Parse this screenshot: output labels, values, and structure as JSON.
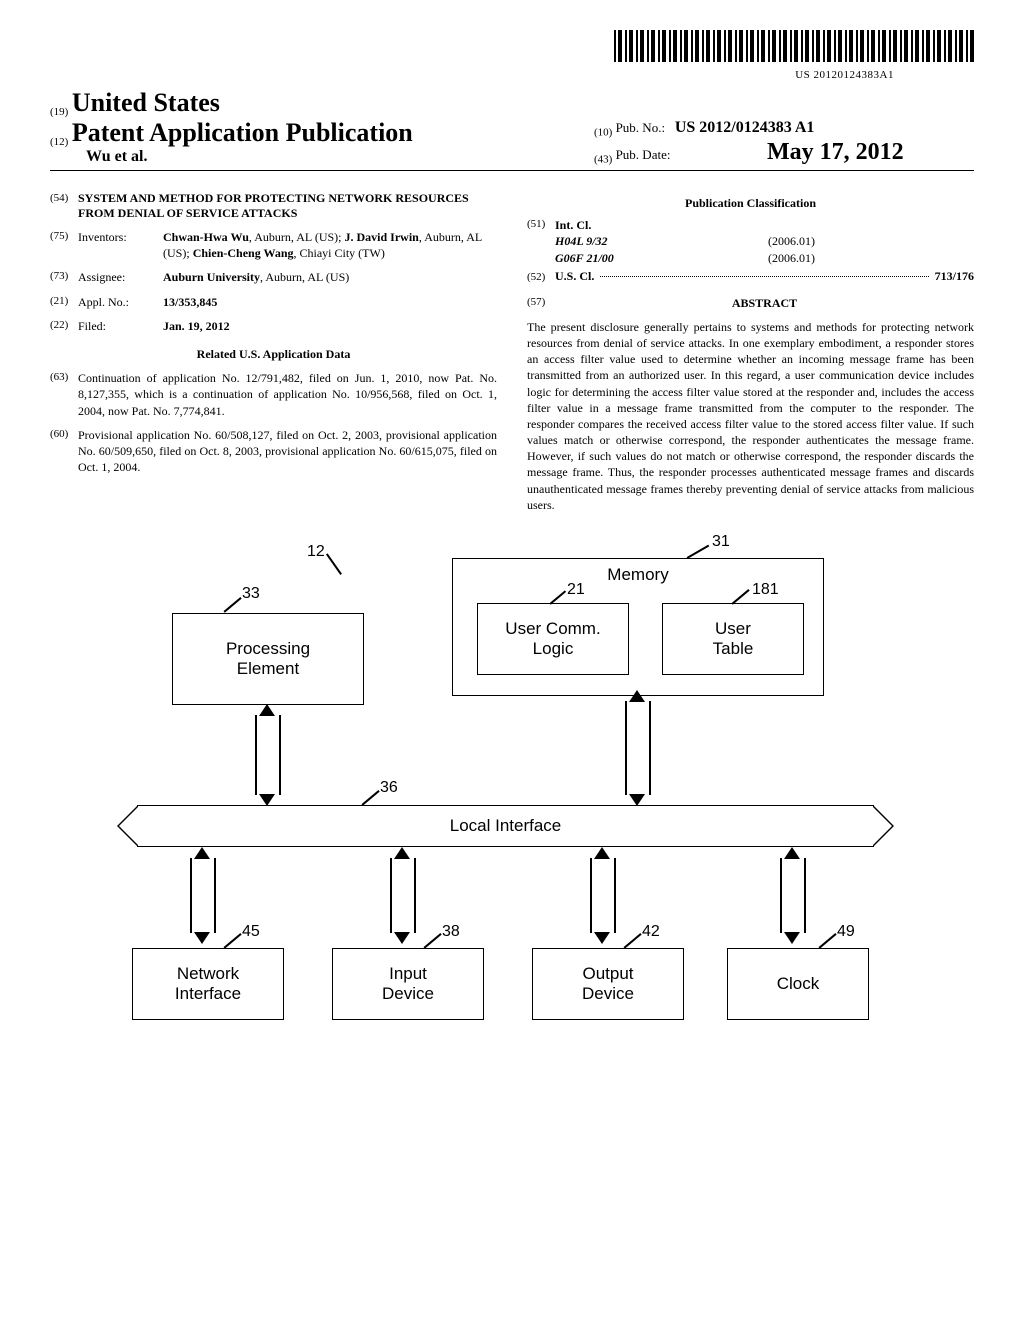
{
  "barcode_text": "US 20120124383A1",
  "header": {
    "country_num": "(19)",
    "country": "United States",
    "pub_num": "(12)",
    "pub_type": "Patent Application Publication",
    "authors": "Wu et al.",
    "right_pubno_num": "(10)",
    "right_pubno_label": "Pub. No.:",
    "right_pubno": "US 2012/0124383 A1",
    "right_date_num": "(43)",
    "right_date_label": "Pub. Date:",
    "right_date": "May 17, 2012"
  },
  "left_col": {
    "title_num": "(54)",
    "title": "SYSTEM AND METHOD FOR PROTECTING NETWORK RESOURCES FROM DENIAL OF SERVICE ATTACKS",
    "inventors_num": "(75)",
    "inventors_label": "Inventors:",
    "inventors": [
      {
        "name": "Chwan-Hwa Wu",
        "loc": "Auburn, AL (US)"
      },
      {
        "name": "J. David Irwin",
        "loc": "Auburn, AL (US)"
      },
      {
        "name": "Chien-Cheng Wang",
        "loc": "Chiayi City (TW)"
      }
    ],
    "assignee_num": "(73)",
    "assignee_label": "Assignee:",
    "assignee": "Auburn University",
    "assignee_loc": "Auburn, AL (US)",
    "appl_num_num": "(21)",
    "appl_num_label": "Appl. No.:",
    "appl_num": "13/353,845",
    "filed_num": "(22)",
    "filed_label": "Filed:",
    "filed": "Jan. 19, 2012",
    "related_heading": "Related U.S. Application Data",
    "cont_num": "(63)",
    "cont_text": "Continuation of application No. 12/791,482, filed on Jun. 1, 2010, now Pat. No. 8,127,355, which is a continuation of application No. 10/956,568, filed on Oct. 1, 2004, now Pat. No. 7,774,841.",
    "prov_num": "(60)",
    "prov_text": "Provisional application No. 60/508,127, filed on Oct. 2, 2003, provisional application No. 60/509,650, filed on Oct. 8, 2003, provisional application No. 60/615,075, filed on Oct. 1, 2004."
  },
  "right_col": {
    "pubclass_heading": "Publication Classification",
    "intcl_num": "(51)",
    "intcl_label": "Int. Cl.",
    "intcl": [
      {
        "code": "H04L 9/32",
        "ver": "(2006.01)"
      },
      {
        "code": "G06F 21/00",
        "ver": "(2006.01)"
      }
    ],
    "uscl_num": "(52)",
    "uscl_label": "U.S. Cl.",
    "uscl_value": "713/176",
    "abstract_num": "(57)",
    "abstract_label": "ABSTRACT",
    "abstract_text": "The present disclosure generally pertains to systems and methods for protecting network resources from denial of service attacks. In one exemplary embodiment, a responder stores an access filter value used to determine whether an incoming message frame has been transmitted from an authorized user. In this regard, a user communication device includes logic for determining the access filter value stored at the responder and, includes the access filter value in a message frame transmitted from the computer to the responder. The responder compares the received access filter value to the stored access filter value. If such values match or otherwise correspond, the responder authenticates the message frame. However, if such values do not match or otherwise correspond, the responder discards the message frame. Thus, the responder processes authenticated message frames and discards unauthenticated message frames thereby preventing denial of service attacks from malicious users."
  },
  "figure": {
    "refs": {
      "r12": "12",
      "r31": "31",
      "r33": "33",
      "r21": "21",
      "r181": "181",
      "r36": "36",
      "r45": "45",
      "r38": "38",
      "r42": "42",
      "r49": "49"
    },
    "boxes": {
      "memory": "Memory",
      "user_comm_logic": "User Comm.\nLogic",
      "user_table": "User\nTable",
      "processing_element": "Processing\nElement",
      "local_interface": "Local Interface",
      "network_interface": "Network\nInterface",
      "input_device": "Input\nDevice",
      "output_device": "Output\nDevice",
      "clock": "Clock"
    }
  }
}
